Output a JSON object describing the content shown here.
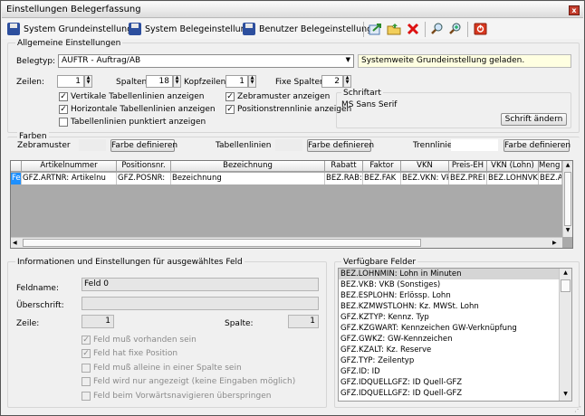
{
  "window": {
    "title": "Einstellungen Belegerfassung"
  },
  "toolbar": {
    "system_grundeinstellung": "System Grundeinstellung",
    "system_belegeinstellung": "System Belegeinstellung",
    "benutzer_belegeinstellung": "Benutzer Belegeinstellung"
  },
  "allgemein": {
    "title": "Allgemeine Einstellungen",
    "belegtyp_label": "Belegtyp:",
    "belegtyp_value": "AUFTR - Auftrag/AB",
    "status": "Systemweite Grundeinstellung geladen.",
    "zeilen_label": "Zeilen:",
    "zeilen_value": "1",
    "spalten_label": "Spalten:",
    "spalten_value": "18",
    "kopfzeilen_label": "Kopfzeilen:",
    "kopfzeilen_value": "1",
    "fixe_spalten_label": "Fixe Spalten:",
    "fixe_spalten_value": "2",
    "checkboxes": [
      {
        "label": "Vertikale Tabellenlinien anzeigen",
        "checked": true
      },
      {
        "label": "Horizontale Tabellenlinien anzeigen",
        "checked": true
      },
      {
        "label": "Tabellenlinien punktiert anzeigen",
        "checked": false
      },
      {
        "label": "Zebramuster anzeigen",
        "checked": true
      },
      {
        "label": "Positionstrennlinie anzeigen",
        "checked": true
      }
    ],
    "schriftart_label": "Schriftart",
    "schriftart_value": "MS Sans Serif",
    "schrift_button": "Schrift ändern"
  },
  "farben": {
    "title": "Farben",
    "zebramuster": "Zebramuster",
    "tabellenlinien": "Tabellenlinien",
    "trennlinie": "Trennlinie",
    "button": "Farbe definieren"
  },
  "grid": {
    "columns": [
      "Artikelnummer",
      "Positionsnr.",
      "Bezeichnung",
      "Rabatt",
      "Faktor",
      "VKN",
      "Preis-EH",
      "VKN (Lohn)",
      "Meng"
    ],
    "row": {
      "sel": "Fel",
      "cells": [
        "GFZ.ARTNR: Artikelnu",
        "GFZ.POSNR:",
        "Bezeichnung",
        "BEZ.RAB:",
        "BEZ.FAK",
        "BEZ.VKN: Vk",
        "BEZ.PREI",
        "BEZ.LOHNVK",
        "BEZ.AI"
      ]
    }
  },
  "info": {
    "title": "Informationen und Einstellungen für ausgewähltes Feld",
    "feldname_label": "Feldname:",
    "feldname_value": "Feld 0",
    "ueberschrift_label": "Überschrift:",
    "ueberschrift_value": "",
    "zeile_label": "Zeile:",
    "zeile_value": "1",
    "spalte_label": "Spalte:",
    "spalte_value": "1",
    "options": [
      {
        "label": "Feld muß vorhanden sein",
        "checked": true
      },
      {
        "label": "Feld hat fixe Position",
        "checked": true
      },
      {
        "label": "Feld muß alleine in einer Spalte sein",
        "checked": false
      },
      {
        "label": "Feld wird nur angezeigt (keine Eingaben möglich)",
        "checked": false
      },
      {
        "label": "Feld beim Vorwärtsnavigieren überspringen",
        "checked": false
      }
    ]
  },
  "felder": {
    "title": "Verfügbare Felder",
    "items": [
      "BEZ.LOHNMIN: Lohn in Minuten",
      "BEZ.VKB: VKB (Sonstiges)",
      "BEZ.ESPLOHN: Erlössp. Lohn",
      "BEZ.KZMWSTLOHN: Kz. MWSt. Lohn",
      "GFZ.KZTYP: Kennz. Typ",
      "GFZ.KZGWART: Kennzeichen GW-Verknüpfung",
      "GFZ.GWKZ: GW-Kennzeichen",
      "GFZ.KZALT: Kz. Reserve",
      "GFZ.TYP: Zeilentyp",
      "GFZ.ID: ID",
      "GFZ.IDQUELLGFZ: ID Quell-GFZ",
      "GFZ.IDQUELLGFZ: ID Quell-GFZ"
    ]
  }
}
